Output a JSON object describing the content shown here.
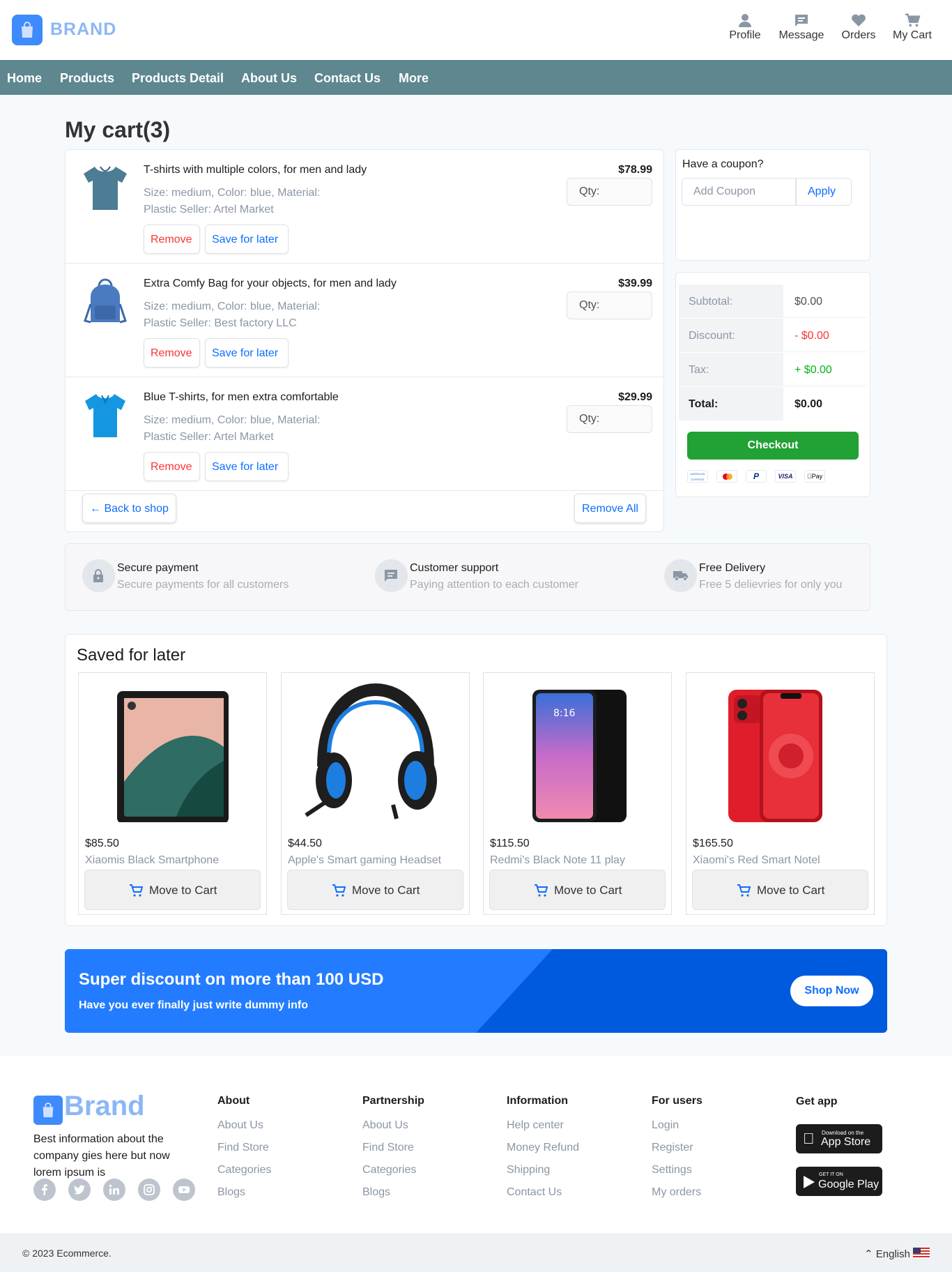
{
  "header": {
    "brand": "BRAND",
    "nav": [
      {
        "label": "Profile",
        "icon": "person-icon"
      },
      {
        "label": "Message",
        "icon": "message-icon"
      },
      {
        "label": "Orders",
        "icon": "heart-icon"
      },
      {
        "label": "My Cart",
        "icon": "cart-icon"
      }
    ]
  },
  "menu": [
    "Home",
    "Products",
    "Products Detail",
    "About Us",
    "Contact Us",
    "More"
  ],
  "cart": {
    "title": "My cart(3)",
    "items": [
      {
        "name": "T-shirts with multiple colors, for men and lady",
        "meta1": "Size: medium, Color: blue, Material:",
        "meta2": "Plastic Seller: Artel Market",
        "price": "$78.99",
        "qty": "Qty:",
        "remove": "Remove",
        "save": "Save for later"
      },
      {
        "name": "Extra Comfy Bag for your objects, for men and lady",
        "meta1": "Size: medium, Color: blue, Material:",
        "meta2": "Plastic Seller: Best factory LLC",
        "price": "$39.99",
        "qty": "Qty:",
        "remove": "Remove",
        "save": "Save for later"
      },
      {
        "name": "Blue T-shirts, for men extra comfortable",
        "meta1": "Size: medium, Color: blue, Material:",
        "meta2": "Plastic Seller: Artel Market",
        "price": "$29.99",
        "qty": "Qty:",
        "remove": "Remove",
        "save": "Save for later"
      }
    ],
    "back": "← Back to shop",
    "remove_all": "Remove All"
  },
  "coupon": {
    "label": "Have a coupon?",
    "placeholder": "Add Coupon",
    "apply": "Apply"
  },
  "summary": {
    "subtotal_k": "Subtotal:",
    "subtotal_v": "$0.00",
    "discount_k": "Discount:",
    "discount_v": "- $0.00",
    "tax_k": "Tax:",
    "tax_v": "+ $0.00",
    "total_k": "Total:",
    "total_v": "$0.00",
    "checkout": "Checkout",
    "payments": [
      "AMERICAN EXPRESS",
      "mastercard",
      "paypal",
      "VISA",
      "Pay"
    ]
  },
  "features": [
    {
      "t1": "Secure payment",
      "t2": "Secure payments for all customers",
      "icon": "lock-icon"
    },
    {
      "t1": "Customer support",
      "t2": "Paying attention to each customer",
      "icon": "message-icon"
    },
    {
      "t1": "Free Delivery",
      "t2": "Free 5 delievries for only you",
      "icon": "truck-icon"
    }
  ],
  "saved": {
    "title": "Saved for later",
    "items": [
      {
        "price": "$85.50",
        "name": "Xiaomis Black Smartphone",
        "btn": "Move to Cart"
      },
      {
        "price": "$44.50",
        "name": "Apple's Smart gaming Headset",
        "btn": "Move to Cart"
      },
      {
        "price": "$115.50",
        "name": "Redmi's Black Note 11 play",
        "btn": "Move to Cart"
      },
      {
        "price": "$165.50",
        "name": "Xiaomi's Red Smart Notel",
        "btn": "Move to Cart"
      }
    ],
    "phone_time": "8:16"
  },
  "banner": {
    "title": "Super discount on more than 100 USD",
    "subtitle": "Have you ever finally just write dummy info",
    "cta": "Shop Now"
  },
  "footer": {
    "brand": "Brand",
    "desc1": "Best information about the",
    "desc2": "company gies here but now",
    "desc3": "lorem ipsum is",
    "cols": [
      {
        "h": "About",
        "links": [
          "About Us",
          "Find Store",
          "Categories",
          "Blogs"
        ]
      },
      {
        "h": "Partnership",
        "links": [
          "About Us",
          "Find Store",
          "Categories",
          "Blogs"
        ]
      },
      {
        "h": "Information",
        "links": [
          "Help center",
          "Money Refund",
          "Shipping",
          "Contact Us"
        ]
      },
      {
        "h": "For users",
        "links": [
          "Login",
          "Register",
          "Settings",
          "My orders"
        ]
      }
    ],
    "get_app": "Get app",
    "appstore_small": "Download on the",
    "appstore_big": "App Store",
    "gplay_small": "GET IT ON",
    "gplay_big": "Google Play",
    "copyright": "© 2023 Ecommerce.",
    "lang": "English"
  },
  "colors": {
    "nav": "#5e878f",
    "accent": "#0d6efd",
    "remove": "#fa3434",
    "checkout": "#22a135",
    "banner": "#237cff"
  }
}
